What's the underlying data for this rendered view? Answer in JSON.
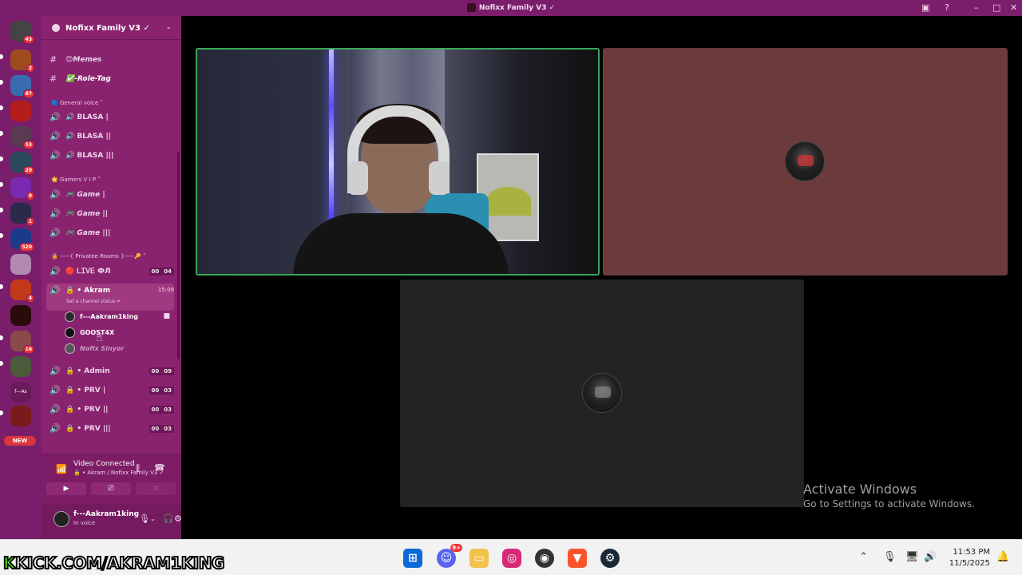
{
  "window": {
    "title": "Nofixx Family V3 ✓"
  },
  "server": {
    "name": "Nofixx Family V3 ✓"
  },
  "guild_badges": [
    "43",
    "2",
    "87",
    "",
    "53",
    "20",
    "9",
    "1",
    "520",
    "",
    "4",
    "",
    "16",
    "",
    "f---As"
  ],
  "new_badge": "NEW",
  "text_channels": [
    {
      "name": "😊Memes"
    },
    {
      "name": "✅-Role-Tag"
    }
  ],
  "categories": {
    "general_voice": "🔵 General voice ˅",
    "gamers_vip": "🌟 Gamers V I P ˅",
    "private_rooms": "🔒 -----{ Privatee Rooms }-----🔑 ˅"
  },
  "general_voice_channels": [
    {
      "name": "🔊 BLASA |"
    },
    {
      "name": "🔊 BLASA ||"
    },
    {
      "name": "🔊 BLASA |||"
    }
  ],
  "gamer_channels": [
    {
      "name": "🎮 Game |"
    },
    {
      "name": "🎮 Game ||"
    },
    {
      "name": "🎮 Game |||"
    }
  ],
  "private_rooms": [
    {
      "name": "🔴 ᏞᏆᏙᎬ ФЛ",
      "count_a": "00",
      "count_b": "04"
    },
    {
      "name": "🔒 • Akram",
      "timer": "15:09",
      "status": "Set a channel status ✏"
    },
    {
      "name": "🔒 • Admin",
      "count_a": "00",
      "count_b": "09"
    },
    {
      "name": "🔒 • PRV |",
      "count_a": "00",
      "count_b": "03"
    },
    {
      "name": "🔒 • PRV ||",
      "count_a": "00",
      "count_b": "03"
    },
    {
      "name": "🔒 • PRV |||",
      "count_a": "00",
      "count_b": "03"
    }
  ],
  "voice_members": [
    {
      "name": "f---Aakram1king"
    },
    {
      "name": "GOOST4X"
    },
    {
      "name": "Nofix Sinyor"
    }
  ],
  "voice_panel": {
    "status": "Video Connected",
    "location": "🔒 • Akram / Nofixx Family V3 ✓"
  },
  "user_panel": {
    "username": "f---Aakram1king",
    "status": "In voice"
  },
  "watermark": {
    "line1": "Activate Windows",
    "line2": "Go to Settings to activate Windows."
  },
  "overlay": {
    "prefix": "K",
    "text": "KICK.COM/AKRAM1KING"
  },
  "taskbar": {
    "time": "11:53 PM",
    "date": "11/5/2025",
    "discord_badge": "9+"
  }
}
